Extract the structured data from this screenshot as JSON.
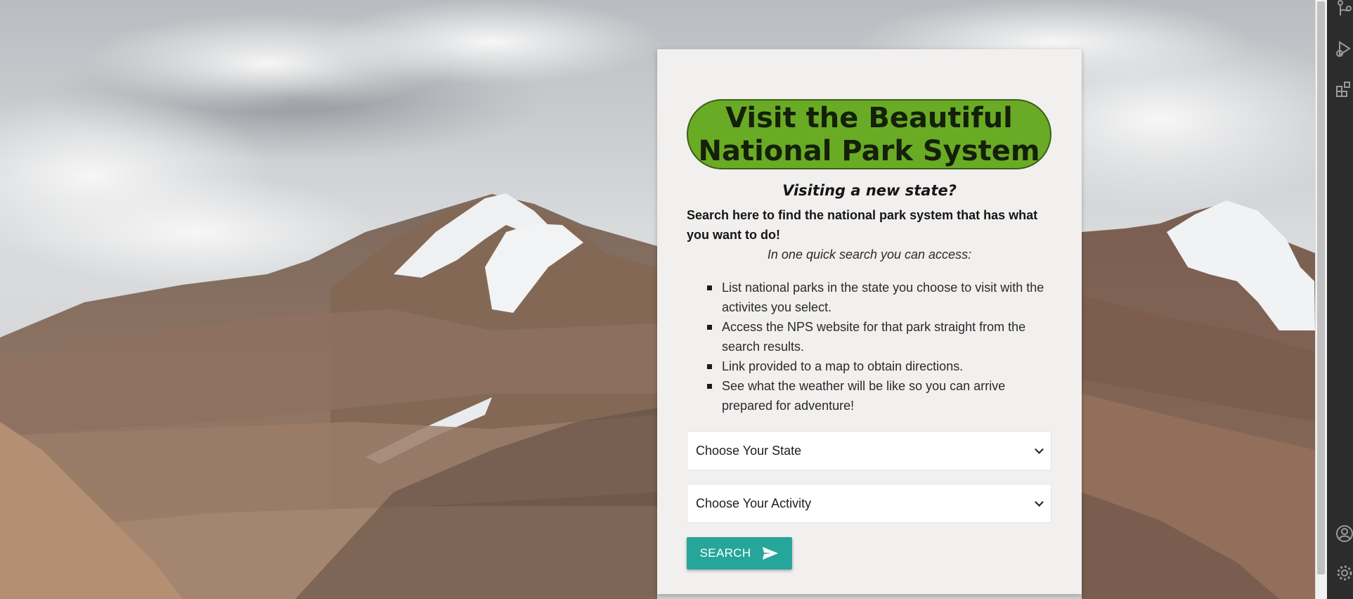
{
  "card": {
    "title_line1": "Visit the Beautiful",
    "title_line2": "National Park System",
    "subtitle": "Visiting a new state?",
    "lead": "Search here to find the national park system that has what you want to do!",
    "access_intro": "In one quick search you can access:",
    "features": [
      "List national parks in the state you choose to visit with the activites you select.",
      "Access the NPS website for that park straight from the search results.",
      "Link provided to a map to obtain directions.",
      "See what the weather will be like so you can arrive prepared for adventure!"
    ]
  },
  "form": {
    "state_select": {
      "selected": "Choose Your State"
    },
    "activity_select": {
      "selected": "Choose Your Activity"
    },
    "search_button": {
      "label": "SEARCH",
      "icon": "send-icon"
    }
  },
  "background": {
    "subject": "mountain-landscape-image"
  },
  "activity_bar": {
    "icons": [
      "source-control-icon",
      "run-debug-icon",
      "extensions-icon",
      "account-icon",
      "settings-gear-icon"
    ]
  },
  "colors": {
    "title_pill": "#6aab25",
    "button": "#26a69a",
    "card_bg": "#f2f0ef"
  }
}
